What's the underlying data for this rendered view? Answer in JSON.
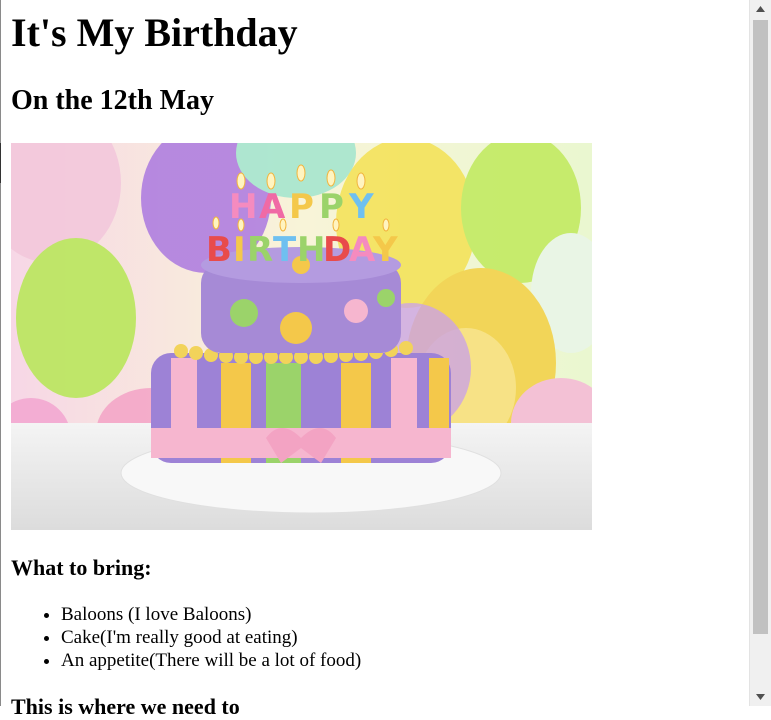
{
  "page": {
    "title": "It's My Birthday",
    "subtitle": "On the 12th May",
    "section_heading": "What to bring:",
    "bring_items": [
      "Baloons (I love Baloons)",
      "Cake(I'm really good at eating)",
      "An appetite(There will be a lot of food)"
    ],
    "cutoff_text": "This is where we need to"
  },
  "hero_image": {
    "caption_letters_top": [
      "H",
      "A",
      "P",
      "P",
      "Y"
    ],
    "caption_letters_bottom": [
      "B",
      "I",
      "R",
      "T",
      "H",
      "D",
      "A",
      "Y"
    ]
  },
  "scrollbar": {
    "up_icon": "scroll-up-arrow-icon",
    "down_icon": "scroll-down-arrow-icon",
    "position": 0.0
  },
  "colors": {
    "balloon_purple": "#b07fe0",
    "balloon_yellow": "#f4e35b",
    "balloon_green": "#b9e75c",
    "cake_purple": "#9d82d6",
    "ribbon_pink": "#f6b6cf",
    "scrollbar_thumb": "#c1c1c1"
  }
}
